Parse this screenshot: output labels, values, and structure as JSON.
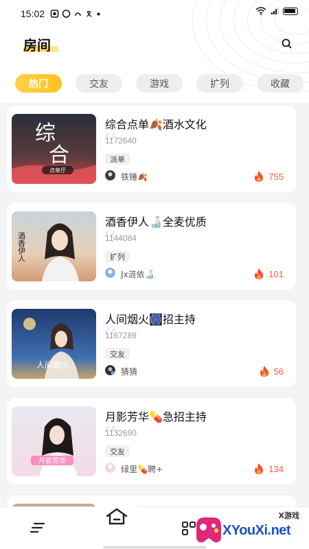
{
  "status_bar": {
    "time": "15:02"
  },
  "header": {
    "title": "房间"
  },
  "tabs": [
    {
      "label": "热门",
      "active": true
    },
    {
      "label": "交友",
      "active": false
    },
    {
      "label": "游戏",
      "active": false
    },
    {
      "label": "扩列",
      "active": false
    },
    {
      "label": "收藏",
      "active": false
    }
  ],
  "rooms": [
    {
      "name": "综合点单🍂酒水文化",
      "id": "1172640",
      "tag": "派单",
      "host": "铁锤🍂",
      "heat": "755",
      "cover_text": [
        "综",
        "合",
        "点单厅"
      ]
    },
    {
      "name": "酒香伊人🍶全麦优质",
      "id": "1144084",
      "tag": "扩列",
      "host": "Jx涟依🍶",
      "heat": "101",
      "cover_text": [
        "酒香伊人"
      ]
    },
    {
      "name": "人间烟火🎆招主持",
      "id": "1167289",
      "tag": "交友",
      "host": "猜猜",
      "heat": "56",
      "cover_text": [
        "人间烟火"
      ]
    },
    {
      "name": "月影芳华💊急招主持",
      "id": "1132690",
      "tag": "交友",
      "host": "绿里💊聘+",
      "heat": "134",
      "cover_text": [
        "月影芳华"
      ]
    }
  ],
  "watermark": {
    "small": "X游戏",
    "text": "XYouXi.net"
  },
  "icons": {
    "search": "search-icon",
    "fire": "fire-icon",
    "menu": "menu-icon",
    "home": "home-icon",
    "apps": "apps-icon"
  },
  "colors": {
    "accent": "#ffc21a",
    "heat": "#ff5b3a"
  }
}
